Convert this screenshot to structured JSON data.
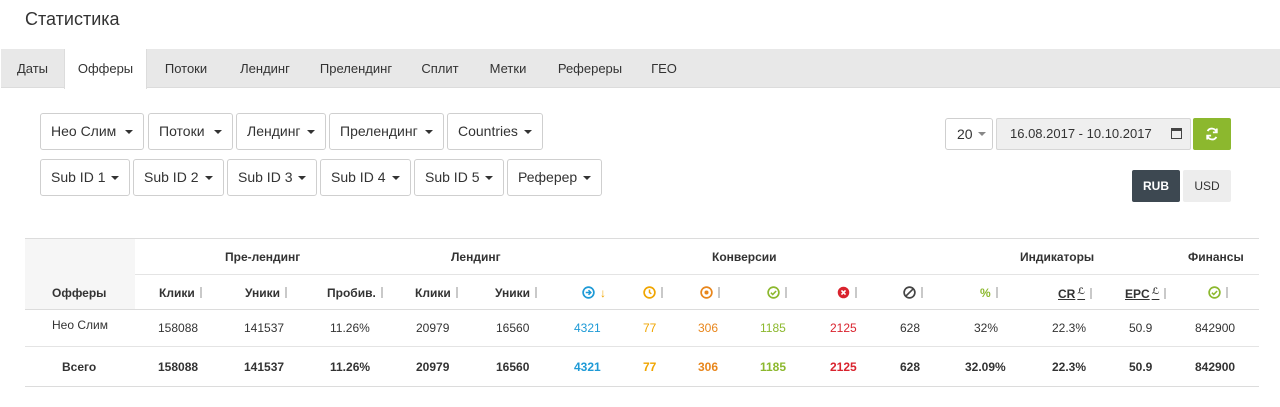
{
  "page_title": "Статистика",
  "tabs": [
    "Даты",
    "Офферы",
    "Потоки",
    "Лендинг",
    "Прелендинг",
    "Сплит",
    "Метки",
    "Рефереры",
    "ГЕО"
  ],
  "active_tab": "Офферы",
  "filters_row1": [
    "Нео Слим",
    "Потоки",
    "Лендинг",
    "Прелендинг",
    "Countries"
  ],
  "filters_row2": [
    "Sub ID 1",
    "Sub ID 2",
    "Sub ID 3",
    "Sub ID 4",
    "Sub ID 5",
    "Реферер"
  ],
  "per_page": "20",
  "date_range": "16.08.2017 - 10.10.2017",
  "currency": {
    "rub": "RUB",
    "usd": "USD",
    "selected": "RUB"
  },
  "table": {
    "groups": [
      "Пре-лендинг",
      "Лендинг",
      "Конверсии",
      "Индикаторы",
      "Финансы"
    ],
    "first_column": "Офферы",
    "headers": {
      "pre_clicks": "Клики",
      "pre_uniques": "Уники",
      "pre_breakthrough": "Пробив.",
      "land_clicks": "Клики",
      "land_uniques": "Уники",
      "percent": "%",
      "cr": "CR",
      "epc": "EPC"
    },
    "colors": {
      "total": "#1e9ad6",
      "hold": "#f0a500",
      "pending": "#e8861c",
      "approved": "#8cb82e",
      "rejected": "#d9232e",
      "trash": "#444444",
      "percent": "#8cb82e"
    },
    "rows": [
      {
        "name": "Нео Слим",
        "pre_clicks": "158088",
        "pre_uniques": "141537",
        "pre_breakthrough": "11.26%",
        "land_clicks": "20979",
        "land_uniques": "16560",
        "conv_total": "4321",
        "conv_hold": "77",
        "conv_pending": "306",
        "conv_approved": "1185",
        "conv_rejected": "2125",
        "conv_trash": "628",
        "percent": "32%",
        "cr": "22.3%",
        "epc": "50.9",
        "finance": "842900"
      },
      {
        "name": "Всего",
        "pre_clicks": "158088",
        "pre_uniques": "141537",
        "pre_breakthrough": "11.26%",
        "land_clicks": "20979",
        "land_uniques": "16560",
        "conv_total": "4321",
        "conv_hold": "77",
        "conv_pending": "306",
        "conv_approved": "1185",
        "conv_rejected": "2125",
        "conv_trash": "628",
        "percent": "32.09%",
        "cr": "22.3%",
        "epc": "50.9",
        "finance": "842900"
      }
    ]
  }
}
